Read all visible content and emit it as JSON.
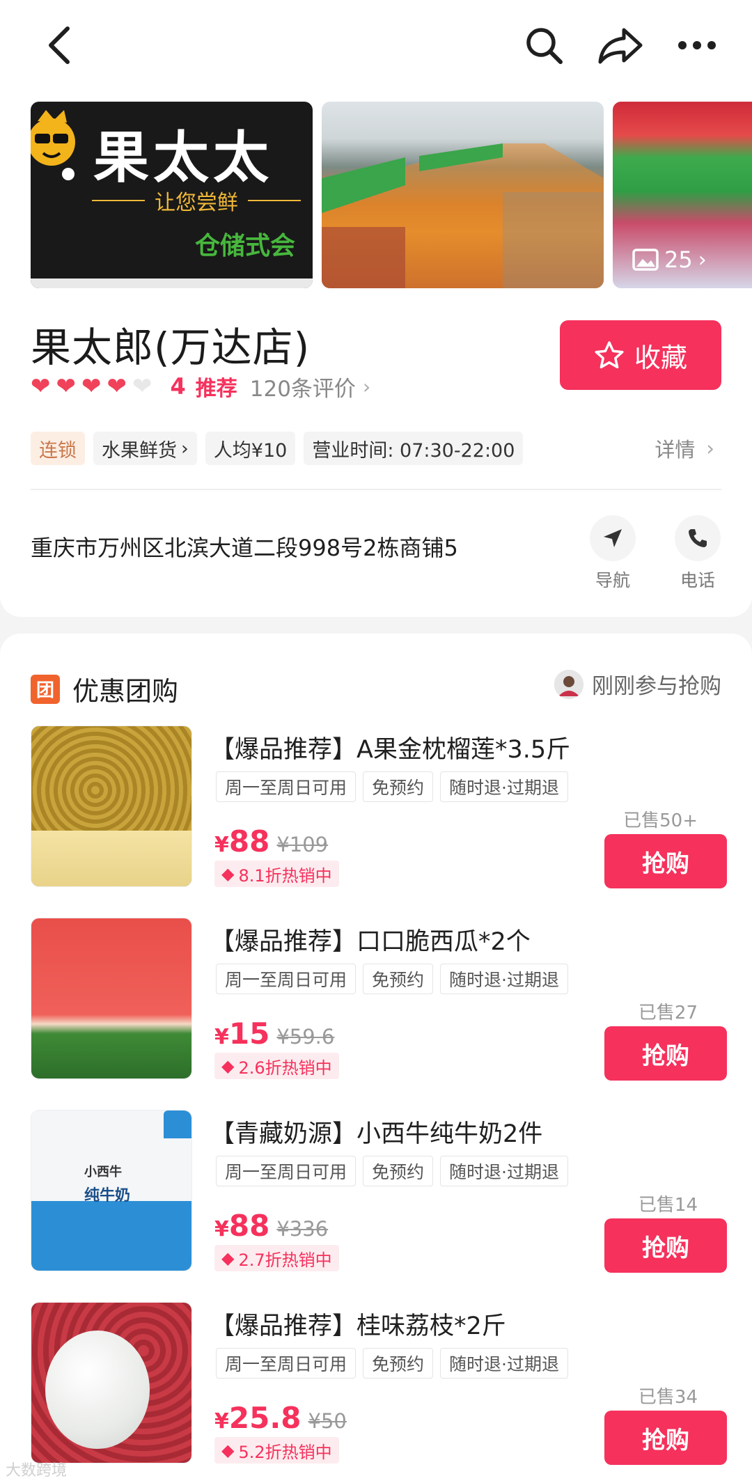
{
  "topbar": {
    "back_icon": "back-arrow-icon",
    "search_icon": "search-icon",
    "share_icon": "share-icon",
    "more_icon": "more-dots-icon"
  },
  "store": {
    "logo_text": "果太太",
    "logo_slogan": "让您尝鲜",
    "logo_sub": "仓储式会",
    "photo_count": "25",
    "name": "果太郎(万达店)",
    "favorite_label": "收藏",
    "rating_hearts_filled": 4,
    "rating_hearts_total": 5,
    "recommend_count": "4",
    "recommend_label": "推荐",
    "review_count": "120条评价",
    "tags": {
      "chain": "连锁",
      "category": "水果鲜货",
      "avg_price": "人均¥10",
      "hours": "营业时间: 07:30-22:00"
    },
    "details_label": "详情",
    "address": "重庆市万州区北滨大道二段998号2栋商铺5",
    "navigate_label": "导航",
    "phone_label": "电话"
  },
  "deals": {
    "section_icon_text": "团",
    "section_title": "优惠团购",
    "recent_text": "刚刚参与抢购",
    "items": [
      {
        "title": "【爆品推荐】A果金枕榴莲*3.5斤",
        "chips": [
          "周一至周日可用",
          "免预约",
          "随时退·过期退"
        ],
        "currency": "¥",
        "price": "88",
        "original_price": "¥109",
        "discount": "8.1折热销中",
        "sold": "已售50+",
        "buy_label": "抢购"
      },
      {
        "title": "【爆品推荐】口口脆西瓜*2个",
        "chips": [
          "周一至周日可用",
          "免预约",
          "随时退·过期退"
        ],
        "currency": "¥",
        "price": "15",
        "original_price": "¥59.6",
        "discount": "2.6折热销中",
        "sold": "已售27",
        "buy_label": "抢购"
      },
      {
        "title": "【青藏奶源】小西牛纯牛奶2件",
        "chips": [
          "周一至周日可用",
          "免预约",
          "随时退·过期退"
        ],
        "currency": "¥",
        "price": "88",
        "original_price": "¥336",
        "discount": "2.7折热销中",
        "sold": "已售14",
        "buy_label": "抢购"
      },
      {
        "title": "【爆品推荐】桂味荔枝*2斤",
        "chips": [
          "周一至周日可用",
          "免预约",
          "随时退·过期退"
        ],
        "currency": "¥",
        "price": "25.8",
        "original_price": "¥50",
        "discount": "5.2折热销中",
        "sold": "已售34",
        "buy_label": "抢购"
      }
    ]
  },
  "milk_brand": "小西牛",
  "milk_label": "纯牛奶",
  "watermark": "大数跨境",
  "colors": {
    "accent": "#f5315c",
    "chain_tag": "#c8794a",
    "tuan_icon": "#f0632d"
  }
}
